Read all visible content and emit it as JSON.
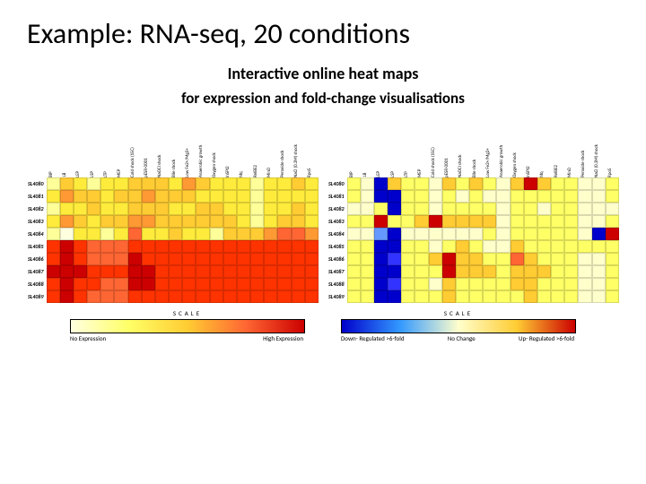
{
  "title": "Example: RNA-seq, 20 conditions",
  "subtitle1": "Interactive online heat maps",
  "subtitle2": "for expression and fold-change visualisations",
  "left_scale": {
    "label": "SCALE",
    "low": "No\nExpression",
    "high": "High\nExpression"
  },
  "right_scale": {
    "label": "SCALE",
    "low": "Down-\nRegulated\n>6-fold",
    "mid": "No\nChange",
    "high": "Up-\nRegulated\n>6-fold"
  },
  "chart_data": [
    {
      "type": "heatmap",
      "name": "expression",
      "palette": "yellow_to_red",
      "rows": [
        "SL4080",
        "SL4081",
        "SL4082",
        "SL4083",
        "SL4084",
        "SL4085",
        "SL4086",
        "SL4087",
        "SL4088",
        "SL4089"
      ],
      "cols": [
        "BIP",
        "LB",
        "LEP",
        "LSP",
        "LTP",
        "MEP",
        "Cold shock (15C)",
        "pESR-0001",
        "NaOCl shock",
        "Bile shock",
        "Low Fe2+/Mg2+",
        "Anaerobic growth",
        "Oxygen shock",
        "InSPI2",
        "hfq",
        "RelBE2",
        "MinD",
        "Peroxide shock",
        "NaCl (0.3M) shock",
        "RpoS"
      ],
      "values": [
        [
          1,
          3,
          2,
          1,
          2,
          2,
          3,
          3,
          3,
          2,
          4,
          3,
          2,
          2,
          2,
          1,
          2,
          2,
          3,
          2
        ],
        [
          2,
          4,
          3,
          3,
          2,
          3,
          3,
          4,
          3,
          3,
          3,
          2,
          2,
          2,
          2,
          1,
          2,
          2,
          2,
          2
        ],
        [
          1,
          2,
          2,
          3,
          2,
          2,
          3,
          3,
          3,
          2,
          2,
          3,
          3,
          2,
          2,
          1,
          2,
          2,
          3,
          2
        ],
        [
          2,
          4,
          3,
          2,
          3,
          3,
          4,
          4,
          3,
          3,
          3,
          3,
          3,
          3,
          2,
          1,
          2,
          3,
          3,
          2
        ],
        [
          1,
          0,
          2,
          2,
          1,
          2,
          5,
          2,
          2,
          3,
          2,
          2,
          1,
          3,
          3,
          3,
          4,
          5,
          5,
          4
        ],
        [
          6,
          7,
          6,
          5,
          5,
          5,
          6,
          6,
          6,
          6,
          6,
          6,
          6,
          6,
          6,
          6,
          6,
          6,
          6,
          6
        ],
        [
          6,
          7,
          6,
          5,
          5,
          5,
          7,
          6,
          6,
          6,
          6,
          6,
          6,
          6,
          6,
          6,
          6,
          6,
          6,
          6
        ],
        [
          7,
          7,
          7,
          6,
          6,
          6,
          7,
          7,
          6,
          6,
          6,
          6,
          6,
          6,
          6,
          6,
          6,
          6,
          6,
          6
        ],
        [
          6,
          7,
          6,
          6,
          5,
          5,
          7,
          7,
          6,
          6,
          6,
          6,
          6,
          6,
          6,
          6,
          6,
          6,
          6,
          6
        ],
        [
          6,
          7,
          6,
          5,
          5,
          5,
          6,
          6,
          6,
          6,
          6,
          6,
          6,
          6,
          6,
          6,
          6,
          6,
          6,
          6
        ]
      ]
    },
    {
      "type": "heatmap",
      "name": "fold_change",
      "palette": "blue_yellow_red",
      "rows": [
        "SL4080",
        "SL4081",
        "SL4082",
        "SL4083",
        "SL4084",
        "SL4085",
        "SL4086",
        "SL4087",
        "SL4088",
        "SL4089"
      ],
      "cols": [
        "BIP",
        "LB",
        "LEP",
        "LSP",
        "LTP",
        "MEP",
        "Cold shock (15C)",
        "pESR-0001",
        "NaOCl shock",
        "Bile shock",
        "Low Fe2+/Mg2+",
        "Anaerobic growth",
        "Oxygen shock",
        "InSPI2",
        "hfq",
        "RelBE2",
        "MinD",
        "Peroxide shock",
        "NaCl (0.3M) shock",
        "RpoS"
      ],
      "values": [
        [
          4,
          3,
          0,
          5,
          4,
          4,
          3,
          5,
          4,
          5,
          4,
          3,
          5,
          7,
          5,
          4,
          4,
          3,
          3,
          4
        ],
        [
          4,
          3,
          0,
          0,
          4,
          4,
          3,
          4,
          3,
          4,
          3,
          3,
          4,
          4,
          4,
          4,
          4,
          3,
          3,
          4
        ],
        [
          3,
          3,
          4,
          0,
          4,
          4,
          3,
          4,
          4,
          4,
          4,
          3,
          4,
          4,
          3,
          4,
          4,
          3,
          3,
          3
        ],
        [
          4,
          4,
          7,
          4,
          4,
          5,
          7,
          5,
          5,
          5,
          5,
          3,
          4,
          4,
          4,
          4,
          4,
          3,
          3,
          4
        ],
        [
          3,
          3,
          2,
          0,
          3,
          3,
          3,
          3,
          3,
          3,
          4,
          3,
          4,
          4,
          4,
          4,
          4,
          3,
          0,
          7
        ],
        [
          4,
          4,
          0,
          0,
          4,
          4,
          3,
          4,
          5,
          4,
          3,
          3,
          5,
          4,
          4,
          4,
          4,
          4,
          4,
          4
        ],
        [
          4,
          4,
          0,
          1,
          4,
          4,
          5,
          7,
          5,
          5,
          4,
          4,
          6,
          5,
          4,
          4,
          4,
          3,
          3,
          4
        ],
        [
          4,
          4,
          0,
          0,
          4,
          4,
          4,
          7,
          5,
          5,
          5,
          4,
          5,
          5,
          5,
          4,
          4,
          3,
          3,
          4
        ],
        [
          4,
          4,
          0,
          1,
          4,
          4,
          3,
          5,
          4,
          4,
          4,
          4,
          5,
          5,
          4,
          4,
          4,
          3,
          3,
          4
        ],
        [
          4,
          4,
          0,
          0,
          4,
          4,
          4,
          5,
          4,
          4,
          4,
          4,
          4,
          5,
          4,
          4,
          4,
          3,
          3,
          4
        ]
      ]
    }
  ]
}
